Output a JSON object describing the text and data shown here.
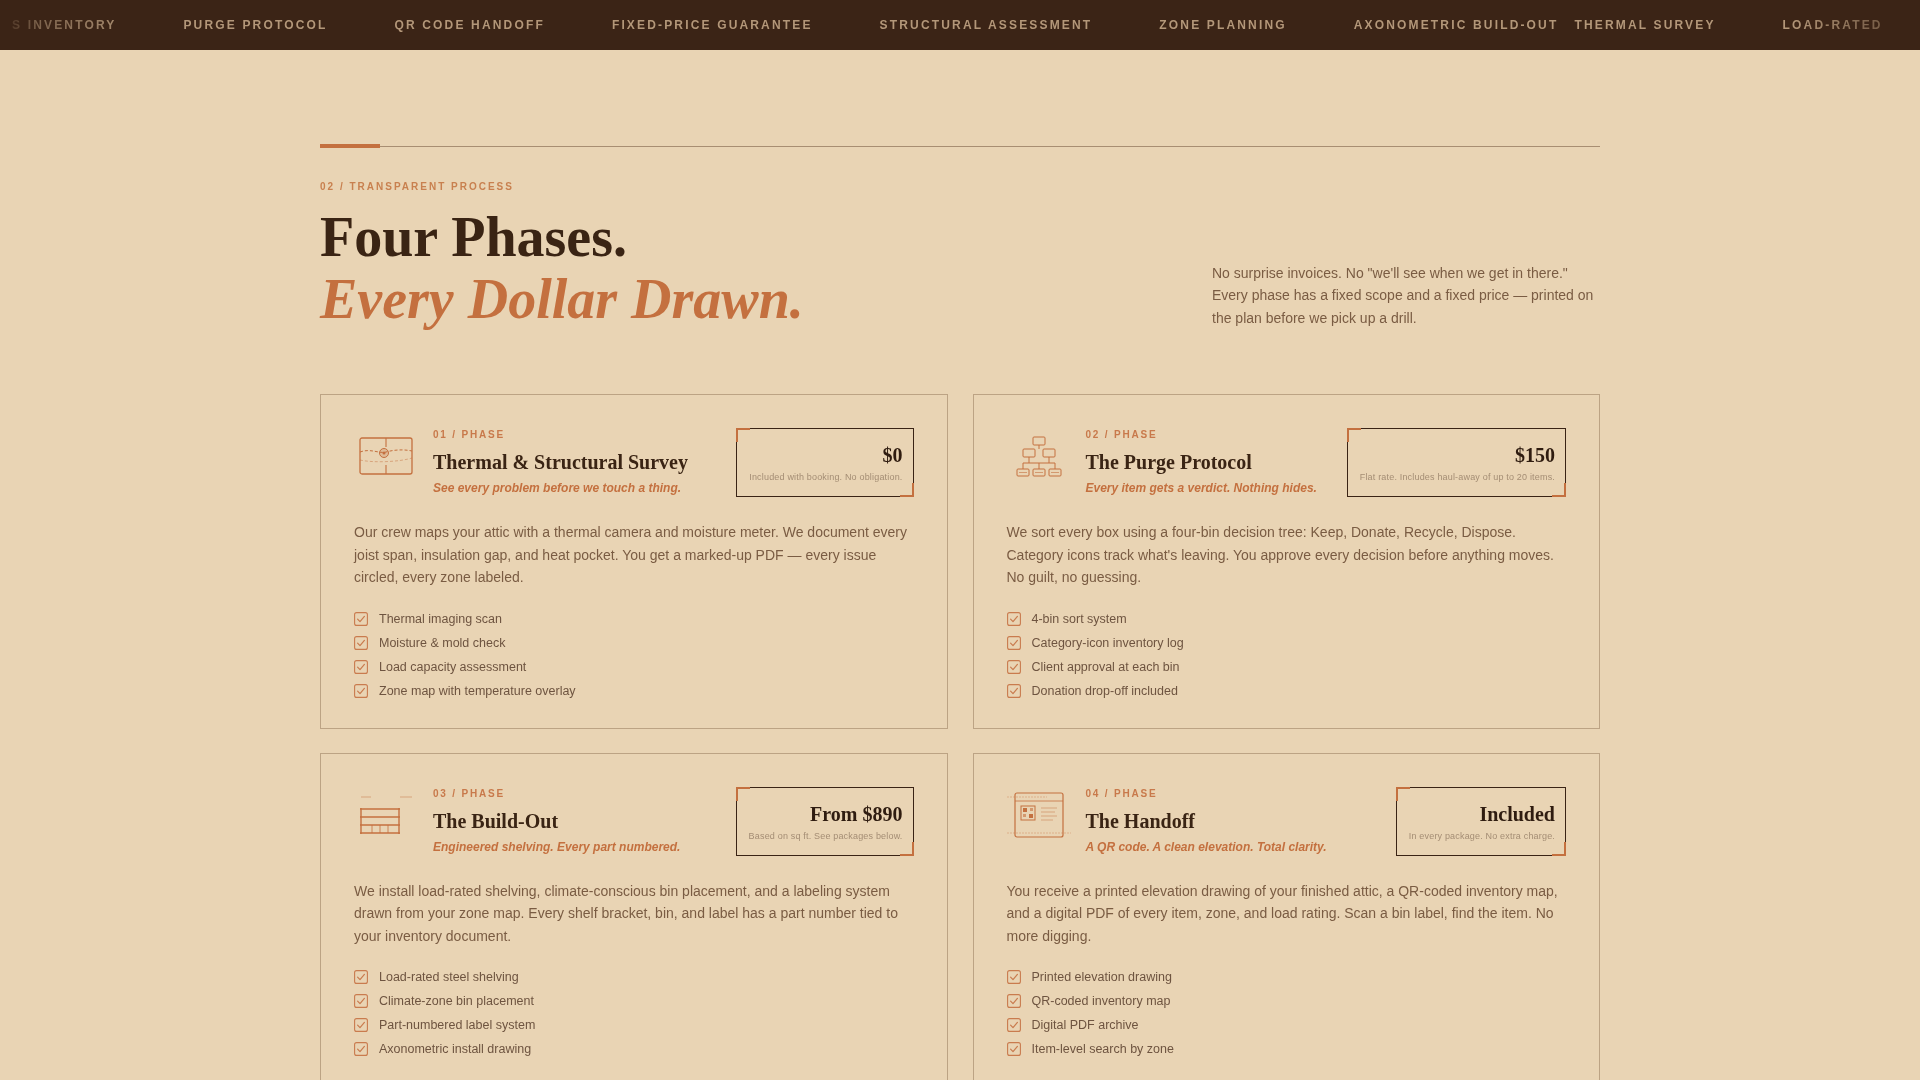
{
  "ticker": {
    "items": [
      "S INVENTORY",
      "PURGE PROTOCOL",
      "QR CODE HANDOFF",
      "FIXED-PRICE GUARANTEE",
      "STRUCTURAL ASSESSMENT",
      "ZONE PLANNING",
      "AXONOMETRIC BUILD-OUT",
      "THERMAL SURVEY",
      "LOAD-RATED"
    ]
  },
  "section": {
    "eyebrow": "02 / TRANSPARENT PROCESS",
    "title": "Four Phases.",
    "title_accent": "Every Dollar Drawn.",
    "intro": "No surprise invoices. No \"we'll see when we get in there.\" Every phase has a fixed scope and a fixed price — printed on the plan before we pick up a drill."
  },
  "phases": [
    {
      "kind": "survey",
      "label": "01 / PHASE",
      "title": "Thermal & Structural Survey",
      "tagline": "See every problem before we touch a thing.",
      "price": "$0",
      "price_note": "Included with booking. No obligation.",
      "description": "Our crew maps your attic with a thermal camera and moisture meter. We document every joist span, insulation gap, and heat pocket. You get a marked-up PDF — every issue circled, every zone labeled.",
      "features": [
        "Thermal imaging scan",
        "Moisture & mold check",
        "Load capacity assessment",
        "Zone map with temperature overlay"
      ]
    },
    {
      "kind": "purge",
      "label": "02 / PHASE",
      "title": "The Purge Protocol",
      "tagline": "Every item gets a verdict. Nothing hides.",
      "price": "$150",
      "price_note": "Flat rate. Includes haul-away of up to 20 items.",
      "description": "We sort every box using a four-bin decision tree: Keep, Donate, Recycle, Dispose. Category icons track what's leaving. You approve every decision before anything moves. No guilt, no guessing.",
      "features": [
        "4-bin sort system",
        "Category-icon inventory log",
        "Client approval at each bin",
        "Donation drop-off included"
      ]
    },
    {
      "kind": "buildout",
      "label": "03 / PHASE",
      "title": "The Build-Out",
      "tagline": "Engineered shelving. Every part numbered.",
      "price": "From $890",
      "price_note": "Based on sq ft. See packages below.",
      "description": "We install load-rated shelving, climate-conscious bin placement, and a labeling system drawn from your zone map. Every shelf bracket, bin, and label has a part number tied to your inventory document.",
      "features": [
        "Load-rated steel shelving",
        "Climate-zone bin placement",
        "Part-numbered label system",
        "Axonometric install drawing"
      ]
    },
    {
      "kind": "handoff",
      "label": "04 / PHASE",
      "title": "The Handoff",
      "tagline": "A QR code. A clean elevation. Total clarity.",
      "price": "Included",
      "price_note": "In every package. No extra charge.",
      "description": "You receive a printed elevation drawing of your finished attic, a QR-coded inventory map, and a digital PDF of every item, zone, and load rating. Scan a bin label, find the item. No more digging.",
      "features": [
        "Printed elevation drawing",
        "QR-coded inventory map",
        "Digital PDF archive",
        "Item-level search by zone"
      ]
    }
  ]
}
